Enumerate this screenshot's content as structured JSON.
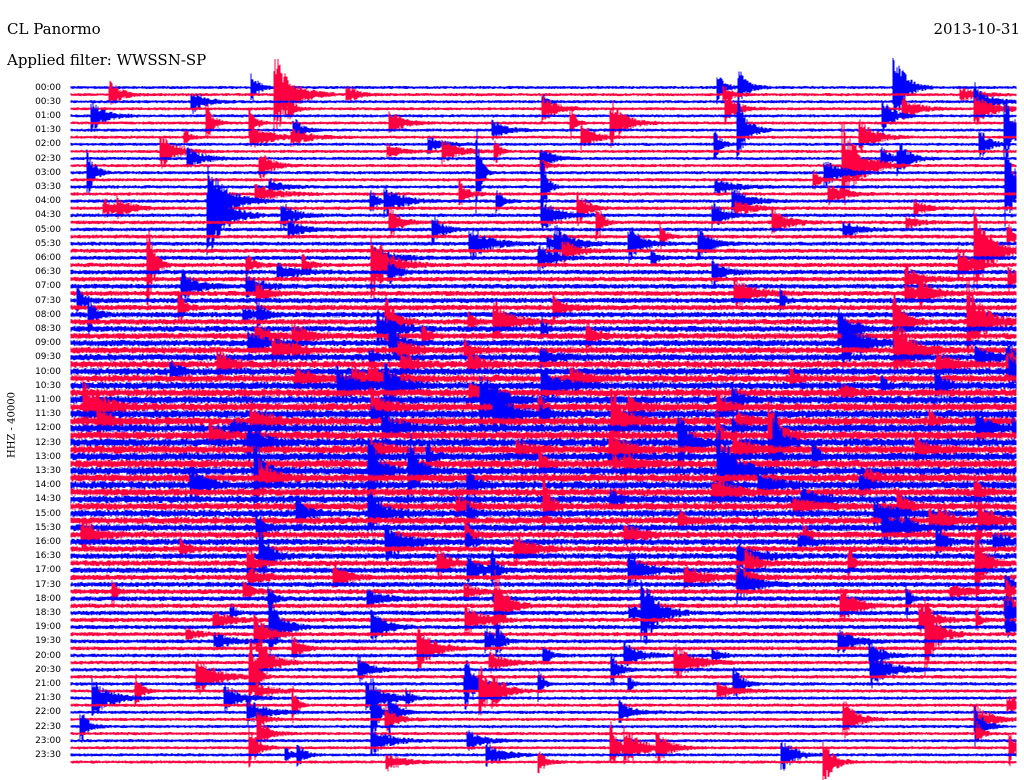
{
  "header": {
    "station": "CL Panormo",
    "filter_label": "Applied filter: WWSSN-SP",
    "date": "2013-10-31"
  },
  "chart_data": {
    "type": "line",
    "chart_kind": "helicorder (seismogram drum plot)",
    "ylabel": "HHZ - 40000",
    "row_labels": [
      "00:00",
      "00:30",
      "01:00",
      "01:30",
      "02:00",
      "02:30",
      "03:00",
      "03:30",
      "04:00",
      "04:30",
      "05:00",
      "05:30",
      "06:00",
      "06:30",
      "07:00",
      "07:30",
      "08:00",
      "08:30",
      "09:00",
      "09:30",
      "10:00",
      "10:30",
      "11:00",
      "11:30",
      "12:00",
      "12:30",
      "13:00",
      "13:30",
      "14:00",
      "14:30",
      "15:00",
      "15:30",
      "16:00",
      "16:30",
      "17:00",
      "17:30",
      "18:00",
      "18:30",
      "19:00",
      "19:30",
      "20:00",
      "20:30",
      "21:00",
      "21:30",
      "22:00",
      "22:30",
      "23:00",
      "23:30"
    ],
    "row_duration_minutes": 15,
    "trace_colors": [
      "#0000ff",
      "#ff0040"
    ],
    "grid": false,
    "legend": "none"
  }
}
